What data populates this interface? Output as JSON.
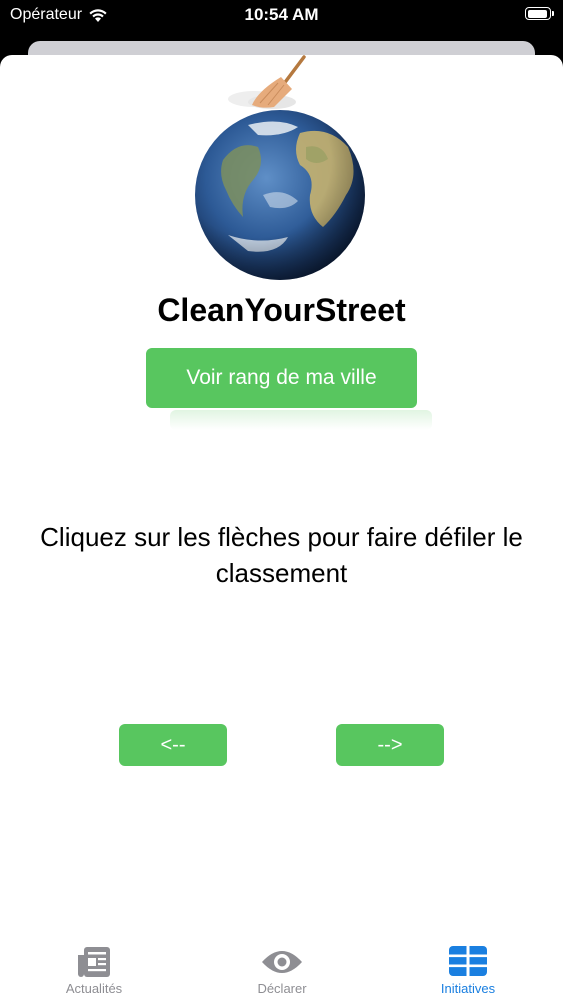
{
  "status_bar": {
    "carrier": "Opérateur",
    "time": "10:54 AM"
  },
  "app": {
    "title": "CleanYourStreet",
    "rank_button": "Voir rang de ma ville",
    "instructions": "Cliquez sur les flèches pour faire défiler le classement",
    "prev_button": "<--",
    "next_button": "-->"
  },
  "tabs": [
    {
      "label": "Actualités",
      "icon": "newspaper-icon",
      "active": false
    },
    {
      "label": "Déclarer",
      "icon": "eye-icon",
      "active": false
    },
    {
      "label": "Initiatives",
      "icon": "grid-icon",
      "active": true
    }
  ],
  "colors": {
    "accent_green": "#58c65f",
    "active_tab": "#1a7fe0",
    "inactive_tab": "#8e8e93"
  }
}
